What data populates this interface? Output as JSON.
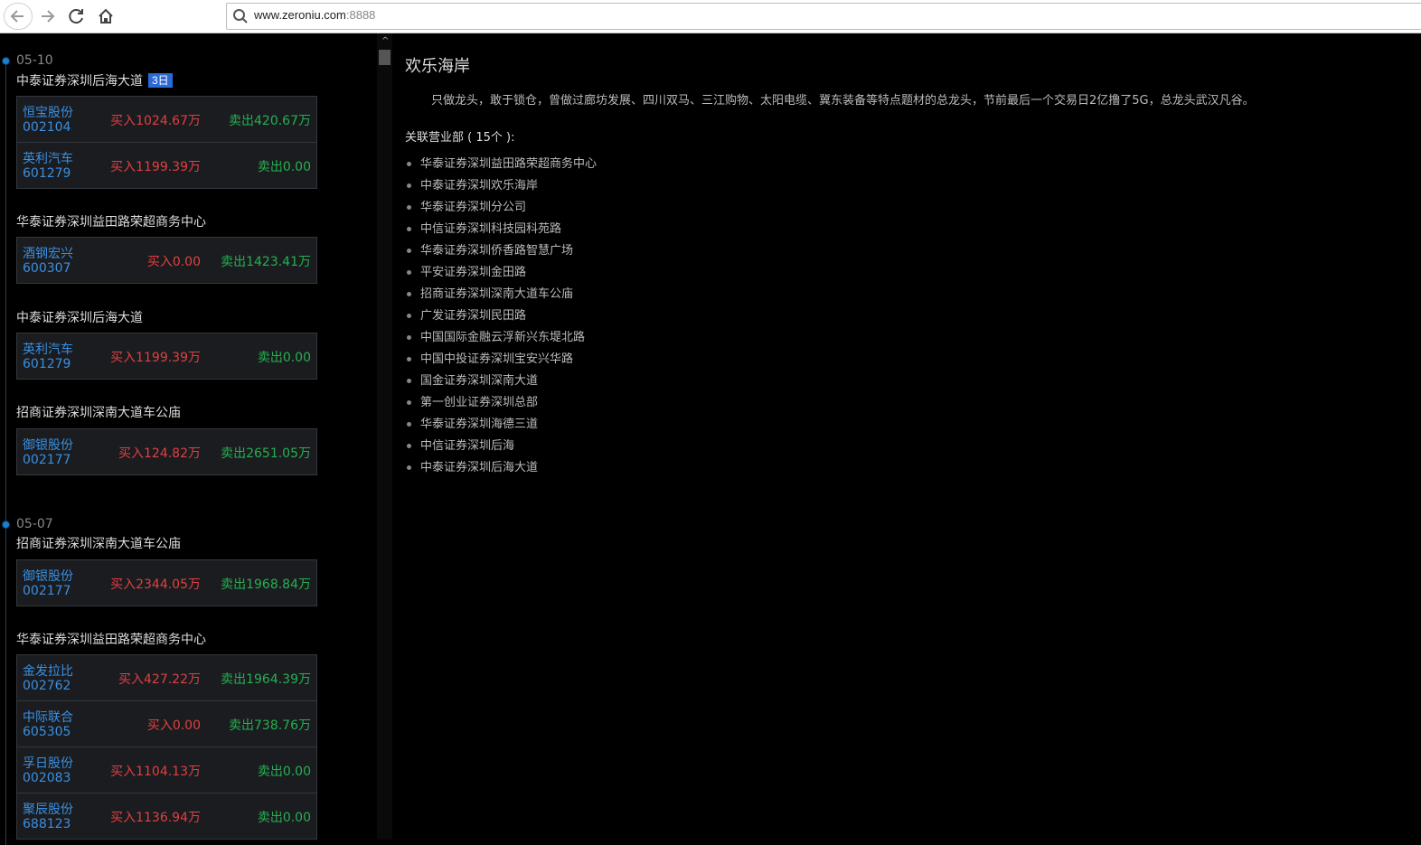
{
  "browser": {
    "url_host": "www.zeroniu.com",
    "url_port": ":8888"
  },
  "timeline": [
    {
      "date": "05-10",
      "groups": [
        {
          "broker": "中泰证券深圳后海大道",
          "badge": "3日",
          "rows": [
            {
              "name": "恒宝股份",
              "code": "002104",
              "buy": "买入1024.67万",
              "sell": "卖出420.67万"
            },
            {
              "name": "英利汽车",
              "code": "601279",
              "buy": "买入1199.39万",
              "sell": "卖出0.00"
            }
          ]
        },
        {
          "broker": "华泰证券深圳益田路荣超商务中心",
          "rows": [
            {
              "name": "酒钢宏兴",
              "code": "600307",
              "buy": "买入0.00",
              "sell": "卖出1423.41万"
            }
          ]
        },
        {
          "broker": "中泰证券深圳后海大道",
          "rows": [
            {
              "name": "英利汽车",
              "code": "601279",
              "buy": "买入1199.39万",
              "sell": "卖出0.00"
            }
          ]
        },
        {
          "broker": "招商证券深圳深南大道车公庙",
          "rows": [
            {
              "name": "御银股份",
              "code": "002177",
              "buy": "买入124.82万",
              "sell": "卖出2651.05万"
            }
          ]
        }
      ]
    },
    {
      "date": "05-07",
      "groups": [
        {
          "broker": "招商证券深圳深南大道车公庙",
          "rows": [
            {
              "name": "御银股份",
              "code": "002177",
              "buy": "买入2344.05万",
              "sell": "卖出1968.84万"
            }
          ]
        },
        {
          "broker": "华泰证券深圳益田路荣超商务中心",
          "rows": [
            {
              "name": "金发拉比",
              "code": "002762",
              "buy": "买入427.22万",
              "sell": "卖出1964.39万"
            },
            {
              "name": "中际联合",
              "code": "605305",
              "buy": "买入0.00",
              "sell": "卖出738.76万"
            },
            {
              "name": "孚日股份",
              "code": "002083",
              "buy": "买入1104.13万",
              "sell": "卖出0.00"
            },
            {
              "name": "聚辰股份",
              "code": "688123",
              "buy": "买入1136.94万",
              "sell": "卖出0.00"
            }
          ]
        }
      ]
    }
  ],
  "detail": {
    "title": "欢乐海岸",
    "description": "只做龙头，敢于锁仓，曾做过廊坊发展、四川双马、三江购物、太阳电缆、冀东装备等特点题材的总龙头，节前最后一个交易日2亿撸了5G，总龙头武汉凡谷。",
    "related_title": "关联营业部 ( 15个 ):",
    "related": [
      "华泰证券深圳益田路荣超商务中心",
      "中泰证券深圳欢乐海岸",
      "华泰证券深圳分公司",
      "中信证券深圳科技园科苑路",
      "华泰证券深圳侨香路智慧广场",
      "平安证券深圳金田路",
      "招商证券深圳深南大道车公庙",
      "广发证券深圳民田路",
      "中国国际金融云浮新兴东堤北路",
      "中国中投证券深圳宝安兴华路",
      "国金证券深圳深南大道",
      "第一创业证券深圳总部",
      "华泰证券深圳海德三道",
      "中信证券深圳后海",
      "中泰证券深圳后海大道"
    ]
  },
  "colors": {
    "buy": "#e04040",
    "sell": "#26b050",
    "stock_link": "#3a8fe0",
    "badge": "#2b6ad6"
  },
  "icons": [
    "back-arrow-icon",
    "forward-arrow-icon",
    "reload-icon",
    "home-icon",
    "search-icon"
  ]
}
